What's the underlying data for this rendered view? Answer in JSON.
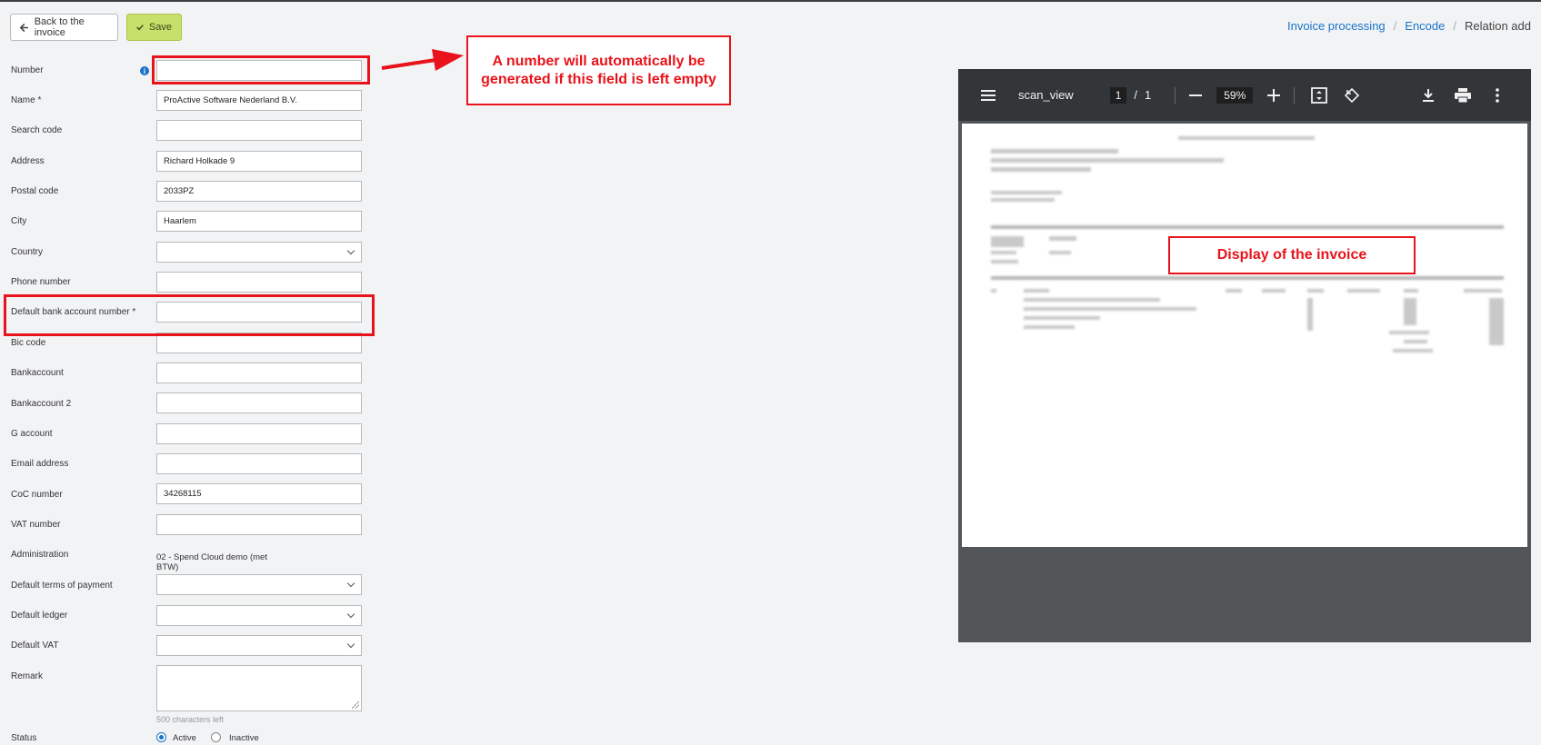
{
  "toolbar": {
    "back_label": "Back to the invoice",
    "save_label": "Save"
  },
  "breadcrumb": {
    "item1": "Invoice processing",
    "item2": "Encode",
    "current": "Relation add",
    "separator": "/"
  },
  "form": {
    "number_label": "Number",
    "info_icon": "i",
    "name_label": "Name *",
    "name_value": "ProActive Software Nederland B.V.",
    "search_code_label": "Search code",
    "address_label": "Address",
    "address_value": "Richard Holkade 9",
    "postal_code_label": "Postal code",
    "postal_code_value": "2033PZ",
    "city_label": "City",
    "city_value": "Haarlem",
    "country_label": "Country",
    "phone_label": "Phone number",
    "bank_default_label": "Default bank account number *",
    "bic_label": "Bic code",
    "bankaccount_label": "Bankaccount",
    "bankaccount2_label": "Bankaccount 2",
    "gaccount_label": "G account",
    "email_label": "Email address",
    "coc_label": "CoC number",
    "coc_value": "34268115",
    "vat_label": "VAT number",
    "admin_label": "Administration",
    "admin_value": "02 - Spend Cloud demo (met BTW)",
    "terms_label": "Default terms of payment",
    "ledger_label": "Default ledger",
    "default_vat_label": "Default VAT",
    "remark_label": "Remark",
    "chars_left": "500 characters left",
    "status_label": "Status",
    "status_active": "Active",
    "status_inactive": "Inactive"
  },
  "annotations": {
    "number_note": "A number will automatically be generated if this field is left empty",
    "display_note": "Display of the invoice"
  },
  "viewer": {
    "title": "scan_view",
    "page_current": "1",
    "page_sep": "/",
    "page_total": "1",
    "zoom": "59%"
  },
  "colors": {
    "accent": "#1a73c8",
    "save": "#c7df6b",
    "annotation": "#e8131b",
    "viewer_bar": "#323639"
  }
}
